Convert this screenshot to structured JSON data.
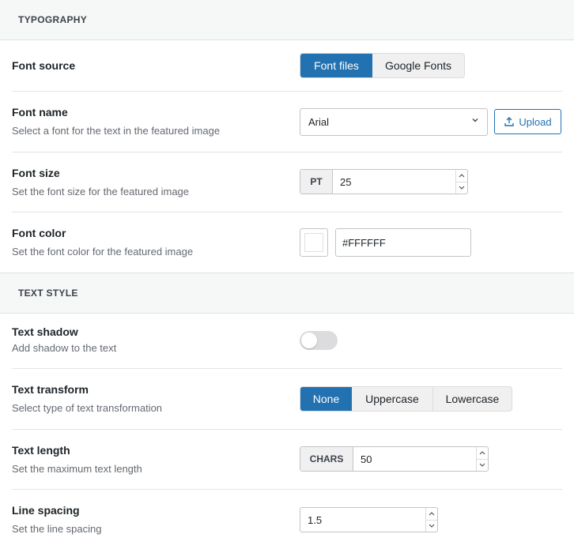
{
  "typography": {
    "header": "TYPOGRAPHY",
    "font_source": {
      "label": "Font source",
      "options": [
        "Font files",
        "Google Fonts"
      ],
      "selected": "Font files"
    },
    "font_name": {
      "label": "Font name",
      "description": "Select a font for the text in the featured image",
      "value": "Arial",
      "upload_label": "Upload"
    },
    "font_size": {
      "label": "Font size",
      "description": "Set the font size for the featured image",
      "unit": "PT",
      "value": "25"
    },
    "font_color": {
      "label": "Font color",
      "description": "Set the font color for the featured image",
      "value": "#FFFFFF"
    }
  },
  "text_style": {
    "header": "TEXT STYLE",
    "text_shadow": {
      "label": "Text shadow",
      "description": "Add shadow to the text",
      "enabled": false
    },
    "text_transform": {
      "label": "Text transform",
      "description": "Select type of text transformation",
      "options": [
        "None",
        "Uppercase",
        "Lowercase"
      ],
      "selected": "None"
    },
    "text_length": {
      "label": "Text length",
      "description": "Set the maximum text length",
      "unit": "CHARS",
      "value": "50"
    },
    "line_spacing": {
      "label": "Line spacing",
      "description": "Set the line spacing",
      "value": "1.5"
    }
  },
  "colors": {
    "accent": "#2271b1",
    "section_bg": "#f6f7f7",
    "toggle_off": "#dcdcde"
  }
}
